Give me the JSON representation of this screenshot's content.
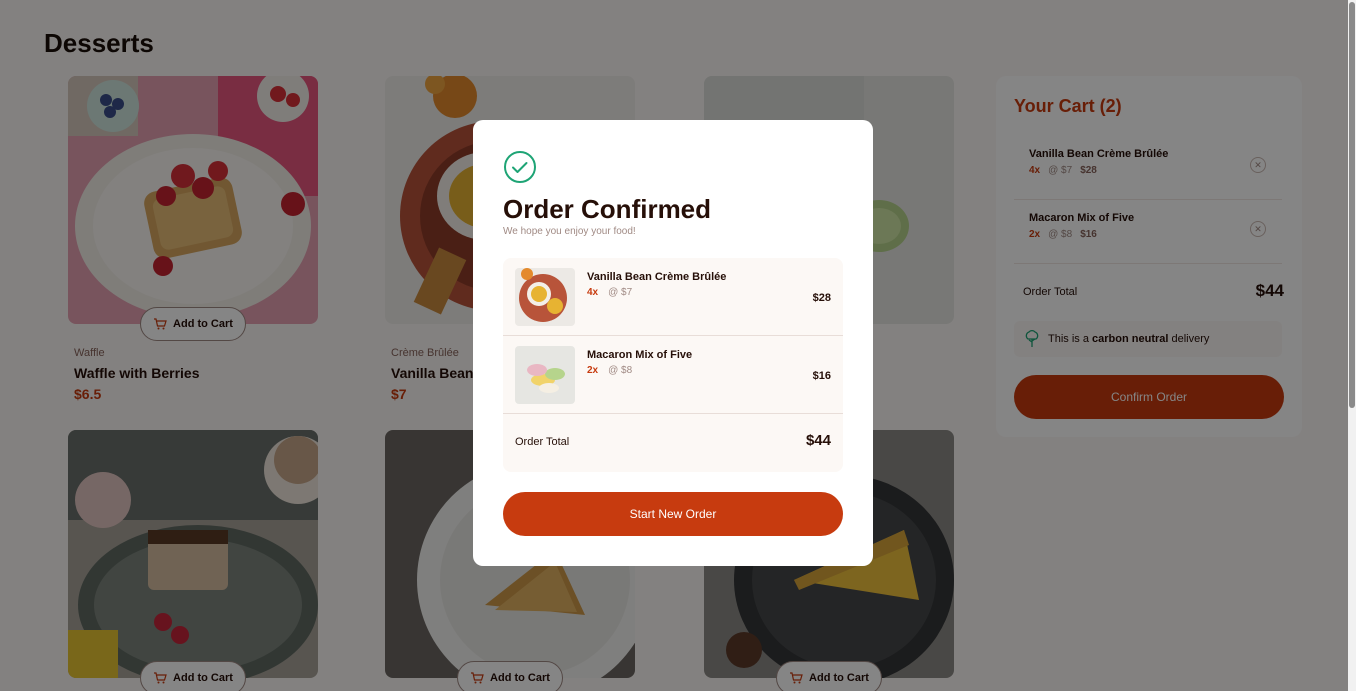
{
  "page": {
    "title": "Desserts"
  },
  "add_to_cart_label": "Add to Cart",
  "products": [
    {
      "category": "Waffle",
      "name": "Waffle with Berries",
      "price": "$6.5"
    },
    {
      "category": "Crème Brûlée",
      "name": "Vanilla Bean Crème Brûlée",
      "price": "$7"
    }
  ],
  "cart": {
    "title": "Your Cart (2)",
    "items": [
      {
        "name": "Vanilla Bean Crème Brûlée",
        "qty": "4x",
        "unit": "@ $7",
        "subtotal": "$28"
      },
      {
        "name": "Macaron Mix of Five",
        "qty": "2x",
        "unit": "@ $8",
        "subtotal": "$16"
      }
    ],
    "total_label": "Order Total",
    "total_value": "$44",
    "carbon_prefix": "This is a",
    "carbon_bold": "carbon neutral",
    "carbon_suffix": "delivery",
    "confirm_label": "Confirm Order",
    "remove_glyph": "✕"
  },
  "modal": {
    "title": "Order Confirmed",
    "subtitle": "We hope you enjoy your food!",
    "items": [
      {
        "name": "Vanilla Bean Crème Brûlée",
        "qty": "4x",
        "unit": "@ $7",
        "subtotal": "$28"
      },
      {
        "name": "Macaron Mix of Five",
        "qty": "2x",
        "unit": "@ $8",
        "subtotal": "$16"
      }
    ],
    "total_label": "Order Total",
    "total_value": "$44",
    "button_label": "Start New Order"
  },
  "colors": {
    "accent": "#c73b0f",
    "success": "#1ea475",
    "text": "#260f08",
    "muted": "#87635a"
  }
}
